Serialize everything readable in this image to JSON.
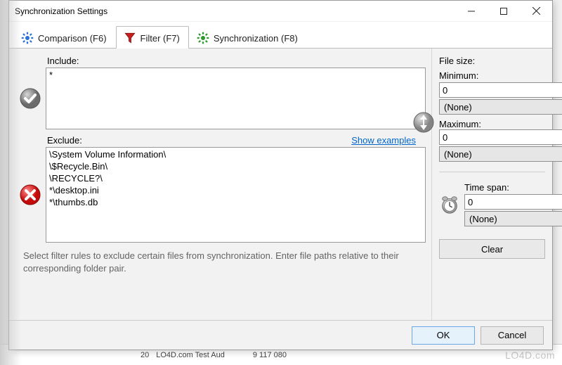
{
  "window": {
    "title": "Synchronization Settings"
  },
  "tabs": {
    "comparison": "Comparison (F6)",
    "filter": "Filter (F7)",
    "sync": "Synchronization (F8)"
  },
  "include": {
    "label": "Include:",
    "value": "*"
  },
  "exclude": {
    "label": "Exclude:",
    "show_examples": "Show examples",
    "value": "\\System Volume Information\\\n\\$Recycle.Bin\\\n\\RECYCLE?\\\n*\\desktop.ini\n*\\thumbs.db"
  },
  "hint": "Select filter rules to exclude certain files from synchronization. Enter file paths relative to their corresponding folder pair.",
  "filesize": {
    "label": "File size:",
    "min_label": "Minimum:",
    "min_value": "0",
    "min_unit": "(None)",
    "max_label": "Maximum:",
    "max_value": "0",
    "max_unit": "(None)"
  },
  "timespan": {
    "label": "Time span:",
    "value": "0",
    "unit": "(None)"
  },
  "buttons": {
    "clear": "Clear",
    "ok": "OK",
    "cancel": "Cancel"
  },
  "watermark": "LO4D.com",
  "bg": {
    "a": "20",
    "b": "LO4D.com    Test Aud",
    "c": "9 117 080"
  }
}
